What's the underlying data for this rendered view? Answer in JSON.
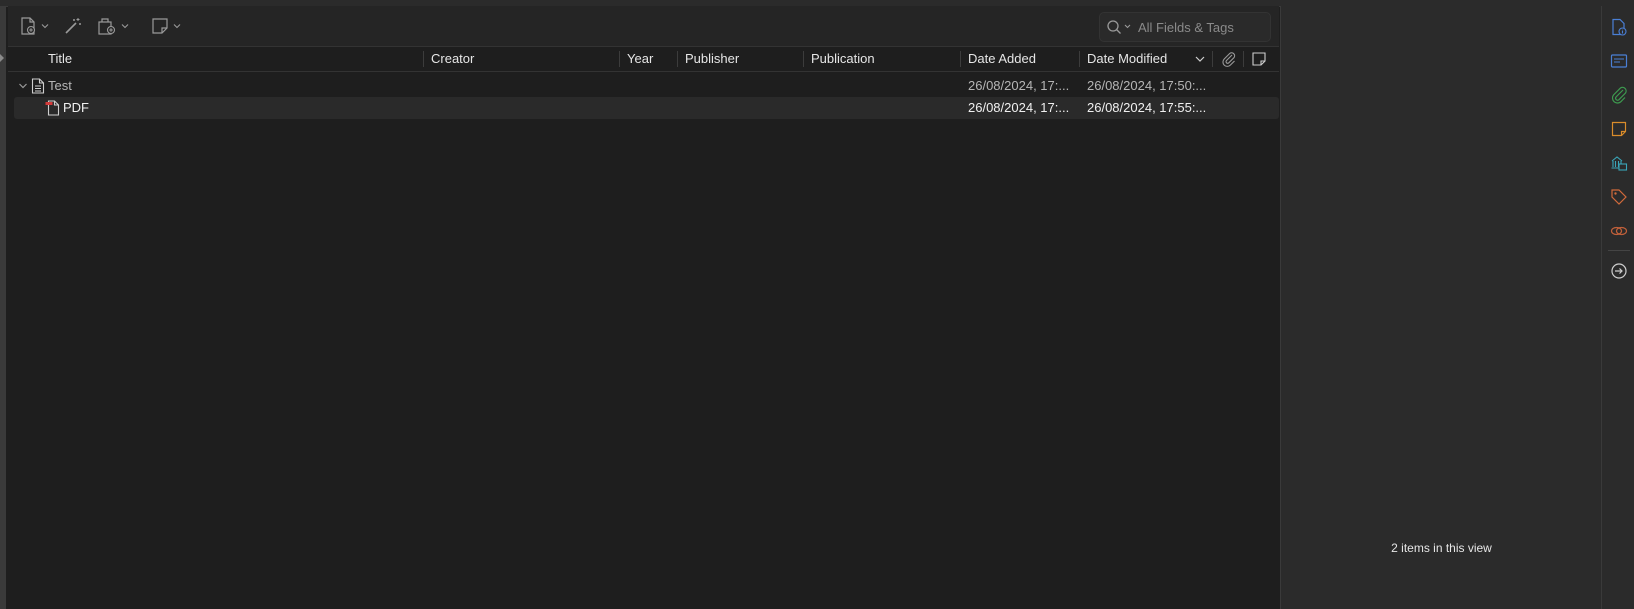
{
  "toolbar": {
    "buttons": [
      {
        "name": "new-item-button",
        "icon": "new-document-icon",
        "has_dropdown": true
      },
      {
        "name": "add-by-identifier-button",
        "icon": "magic-wand-icon",
        "has_dropdown": false
      },
      {
        "name": "add-attachment-button",
        "icon": "attachment-add-icon",
        "has_dropdown": true
      },
      {
        "name": "new-note-button",
        "icon": "note-icon",
        "has_dropdown": true
      }
    ],
    "search": {
      "placeholder": "All Fields & Tags",
      "value": ""
    }
  },
  "columns": {
    "title": "Title",
    "creator": "Creator",
    "year": "Year",
    "publisher": "Publisher",
    "publication": "Publication",
    "date_added": "Date Added",
    "date_modified": "Date Modified"
  },
  "items": [
    {
      "title": "Test",
      "date_added": "26/08/2024, 17:...",
      "date_modified": "26/08/2024, 17:50:...",
      "type": "document",
      "expanded": true
    },
    {
      "title": "PDF",
      "date_added": "26/08/2024, 17:...",
      "date_modified": "26/08/2024, 17:55:...",
      "type": "pdf-attachment"
    }
  ],
  "status": {
    "count_text": "2 items in this view"
  },
  "sidenav": [
    "info-icon",
    "abstract-icon",
    "attachments-icon",
    "notes-icon",
    "libraries-collections-icon",
    "tags-icon",
    "related-icon",
    "locate-icon"
  ],
  "colors": {
    "accent_blue": "#4a7fd6",
    "green": "#3d9a4f",
    "orange": "#d98c2b",
    "teal": "#3aa6b9",
    "tag_orange": "#d06a3b",
    "related_brown": "#c0603a",
    "pdf_red": "#d23a3a"
  }
}
